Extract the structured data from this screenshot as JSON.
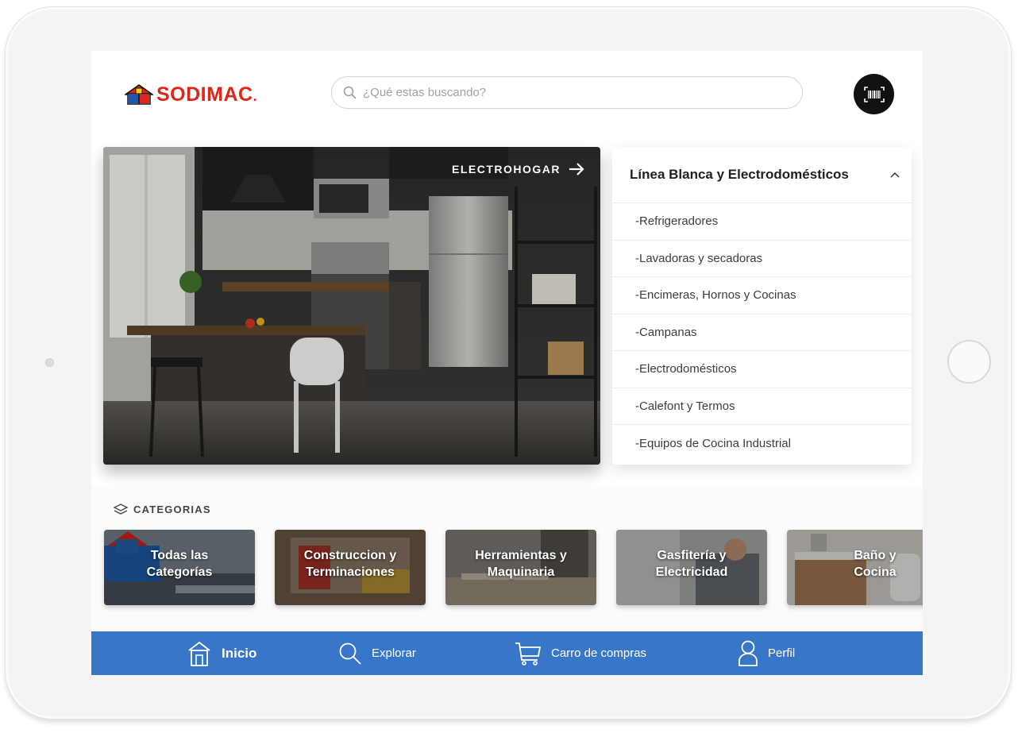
{
  "brand": {
    "name": "SODIMAC",
    "registered_mark": ".",
    "color": "#e1251b"
  },
  "search": {
    "placeholder": "¿Qué estas buscando?"
  },
  "scanner": {
    "icon": "barcode-scan-icon"
  },
  "hero": {
    "link_label": "ELECTROHOGAR",
    "icon": "arrow-right-icon"
  },
  "category_menu": {
    "title": "Línea Blanca y Electrodomésticos",
    "expanded": true,
    "items": [
      {
        "label": "-Refrigeradores"
      },
      {
        "label": "-Lavadoras y secadoras"
      },
      {
        "label": "-Encimeras, Hornos y Cocinas"
      },
      {
        "label": "-Campanas"
      },
      {
        "label": "-Electrodomésticos"
      },
      {
        "label": "-Calefont y Termos"
      },
      {
        "label": "-Equipos de Cocina Industrial"
      }
    ]
  },
  "categories": {
    "heading": "CATEGORIAS",
    "cards": [
      {
        "line1": "Todas las",
        "line2": "Categorías"
      },
      {
        "line1": "Construccion y",
        "line2": "Terminaciones"
      },
      {
        "line1": "Herramientas y",
        "line2": "Maquinaria"
      },
      {
        "line1": "Gasfitería y",
        "line2": "Electricidad"
      },
      {
        "line1": "Baño y",
        "line2": "Cocina"
      }
    ]
  },
  "bottom_nav": {
    "color": "#3876c8",
    "items": [
      {
        "label": "Inicio",
        "icon": "home-icon",
        "active": true
      },
      {
        "label": "Explorar",
        "icon": "search-icon",
        "active": false
      },
      {
        "label": "Carro de compras",
        "icon": "cart-icon",
        "active": false
      },
      {
        "label": "Perfil",
        "icon": "user-icon",
        "active": false
      }
    ]
  }
}
